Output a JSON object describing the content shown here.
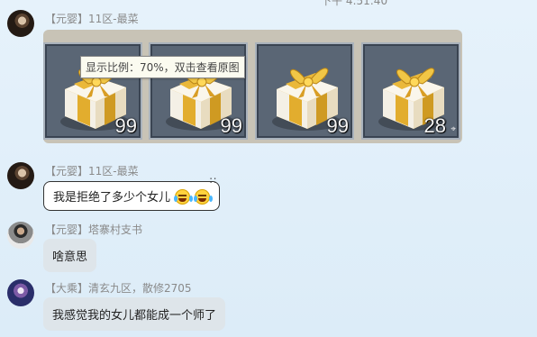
{
  "top_timestamp": "下午 4:51:40",
  "messages": [
    {
      "sender": "【元婴】11区-最菜",
      "type": "image",
      "tooltip": "显示比例：70%，双击查看原图",
      "items": [
        {
          "icon": "gift-box-icon",
          "count": "99"
        },
        {
          "icon": "gift-box-icon",
          "count": "99"
        },
        {
          "icon": "gift-box-icon",
          "count": "99"
        },
        {
          "icon": "gift-box-icon",
          "count": "28"
        }
      ]
    },
    {
      "sender": "【元婴】11区-最菜",
      "type": "text",
      "text": "我是拒绝了多少个女儿",
      "emojis": [
        "laugh-cry-emoji",
        "laugh-cry-emoji"
      ]
    },
    {
      "sender": "【元婴】塔寨村支书",
      "type": "text",
      "text": "啥意思"
    },
    {
      "sender": "【大乘】清玄九区，散修2705",
      "type": "text",
      "text": "我感觉我的女儿都能成一个师了"
    }
  ],
  "colors": {
    "background": "#e2eff9",
    "bubble_gray": "#dee5ea",
    "bubble_white": "#ffffff",
    "slot_bg": "#5a6675",
    "gift_gold": "#e3b53a"
  }
}
